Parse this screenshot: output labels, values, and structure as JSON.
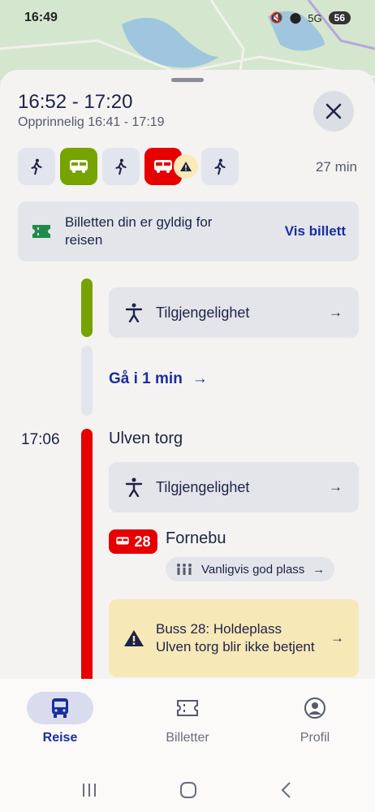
{
  "status_bar": {
    "time": "16:49",
    "battery": "56",
    "network": "5G"
  },
  "trip": {
    "time_range": "16:52 - 17:20",
    "original": "Opprinnelig 16:41 - 17:19",
    "duration": "27 min"
  },
  "legs": [
    {
      "type": "walk",
      "icon": "walk-icon"
    },
    {
      "type": "bus",
      "color": "#76a300",
      "icon": "bus-icon"
    },
    {
      "type": "walk",
      "icon": "walk-icon"
    },
    {
      "type": "bus",
      "color": "#e60000",
      "icon": "bus-icon",
      "warning": true
    },
    {
      "type": "walk",
      "icon": "walk-icon"
    }
  ],
  "ticket": {
    "text": "Billetten din er gyldig for reisen",
    "link": "Vis billett"
  },
  "accessibility_label": "Tilgjengelighet",
  "walk": {
    "label": "Gå i 1 min"
  },
  "stop": {
    "time": "17:06",
    "name": "Ulven torg"
  },
  "line": {
    "number": "28",
    "destination": "Fornebu",
    "capacity": "Vanligvis god plass"
  },
  "alert": {
    "text": "Buss 28: Holdeplass Ulven torg blir ikke betjent"
  },
  "tabs": [
    {
      "label": "Reise",
      "icon": "bus-icon",
      "active": true
    },
    {
      "label": "Billetter",
      "icon": "ticket-icon",
      "active": false
    },
    {
      "label": "Profil",
      "icon": "profile-icon",
      "active": false
    }
  ],
  "colors": {
    "accent": "#1a2ea0",
    "green_line": "#76a300",
    "red_line": "#e60000",
    "alert_bg": "#f7e8b8"
  }
}
